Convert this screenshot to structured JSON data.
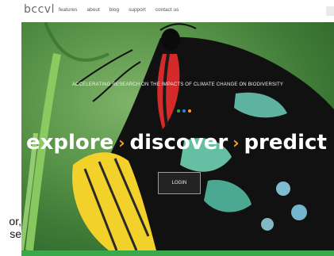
{
  "nav": {
    "logo": "bccvl",
    "links": [
      "features",
      "about",
      "blog",
      "support",
      "contact us"
    ]
  },
  "hero": {
    "tagline": "ACCELERATING RESEARCH ON THE IMPACTS OF CLIMATE CHANGE ON BIODIVERSITY",
    "headline": [
      "explore",
      "discover",
      "predict"
    ],
    "login_label": "LOGIN",
    "dot_colors": [
      "#3aa84b",
      "#1e88e5",
      "#ff9f1c"
    ]
  },
  "left_text": [
    "or,",
    "se"
  ],
  "colors": {
    "accent": "#ff9f1c",
    "bar": "#3aa84b"
  }
}
